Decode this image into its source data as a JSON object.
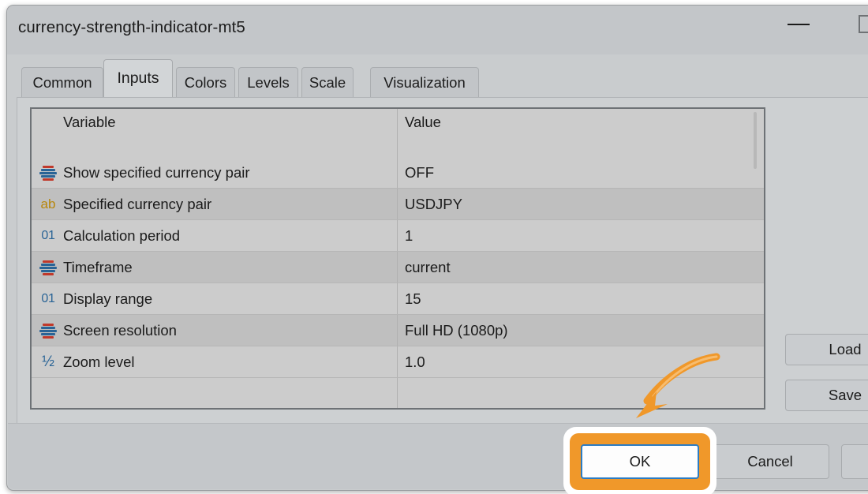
{
  "window": {
    "title": "currency-strength-indicator-mt5",
    "minimize_icon": "minimize-icon",
    "maximize_icon": "maximize-icon"
  },
  "tabs": [
    {
      "label": "Common",
      "active": false
    },
    {
      "label": "Inputs",
      "active": true
    },
    {
      "label": "Colors",
      "active": false
    },
    {
      "label": "Levels",
      "active": false
    },
    {
      "label": "Scale",
      "active": false
    },
    {
      "label": "Visualization",
      "active": false
    }
  ],
  "table": {
    "columns": [
      "Variable",
      "Value"
    ],
    "rows": [
      {
        "icon": "enum-list-icon",
        "icon_type": "enum",
        "variable": "Show specified currency pair",
        "value": "OFF"
      },
      {
        "icon": "string-ab-icon",
        "icon_type": "text",
        "icon_glyph": "ab",
        "variable": "Specified currency pair",
        "value": "USDJPY"
      },
      {
        "icon": "integer-01-icon",
        "icon_type": "int",
        "icon_glyph": "01",
        "variable": "Calculation period",
        "value": "1"
      },
      {
        "icon": "enum-list-icon",
        "icon_type": "enum",
        "variable": "Timeframe",
        "value": "current"
      },
      {
        "icon": "integer-01-icon",
        "icon_type": "int",
        "icon_glyph": "01",
        "variable": "Display range",
        "value": "15"
      },
      {
        "icon": "enum-list-icon",
        "icon_type": "enum",
        "variable": "Screen resolution",
        "value": "Full HD (1080p)"
      },
      {
        "icon": "fraction-half-icon",
        "icon_type": "frac",
        "icon_glyph": "½",
        "variable": "Zoom level",
        "value": "1.0"
      }
    ]
  },
  "side_buttons": [
    {
      "label": "Load"
    },
    {
      "label": "Save"
    }
  ],
  "footer_buttons": [
    {
      "label": "OK",
      "highlighted": true,
      "focused": true
    },
    {
      "label": "Cancel",
      "highlighted": false,
      "focused": false
    }
  ],
  "annotation": {
    "arrow_color": "#f0982a",
    "highlight_color": "#f0982a",
    "points_to": "OK"
  },
  "colors": {
    "dialog_bg": "#c9ccce",
    "titlebar_bg": "#c3c6c9",
    "grid_row_light": "#cccccc",
    "grid_row_dark": "#bfbfbf",
    "focus_blue": "#2b7cc4",
    "accent_orange": "#f0982a",
    "icon_blue": "#2a6496",
    "icon_red": "#c0392b",
    "icon_gold": "#b8860b"
  }
}
